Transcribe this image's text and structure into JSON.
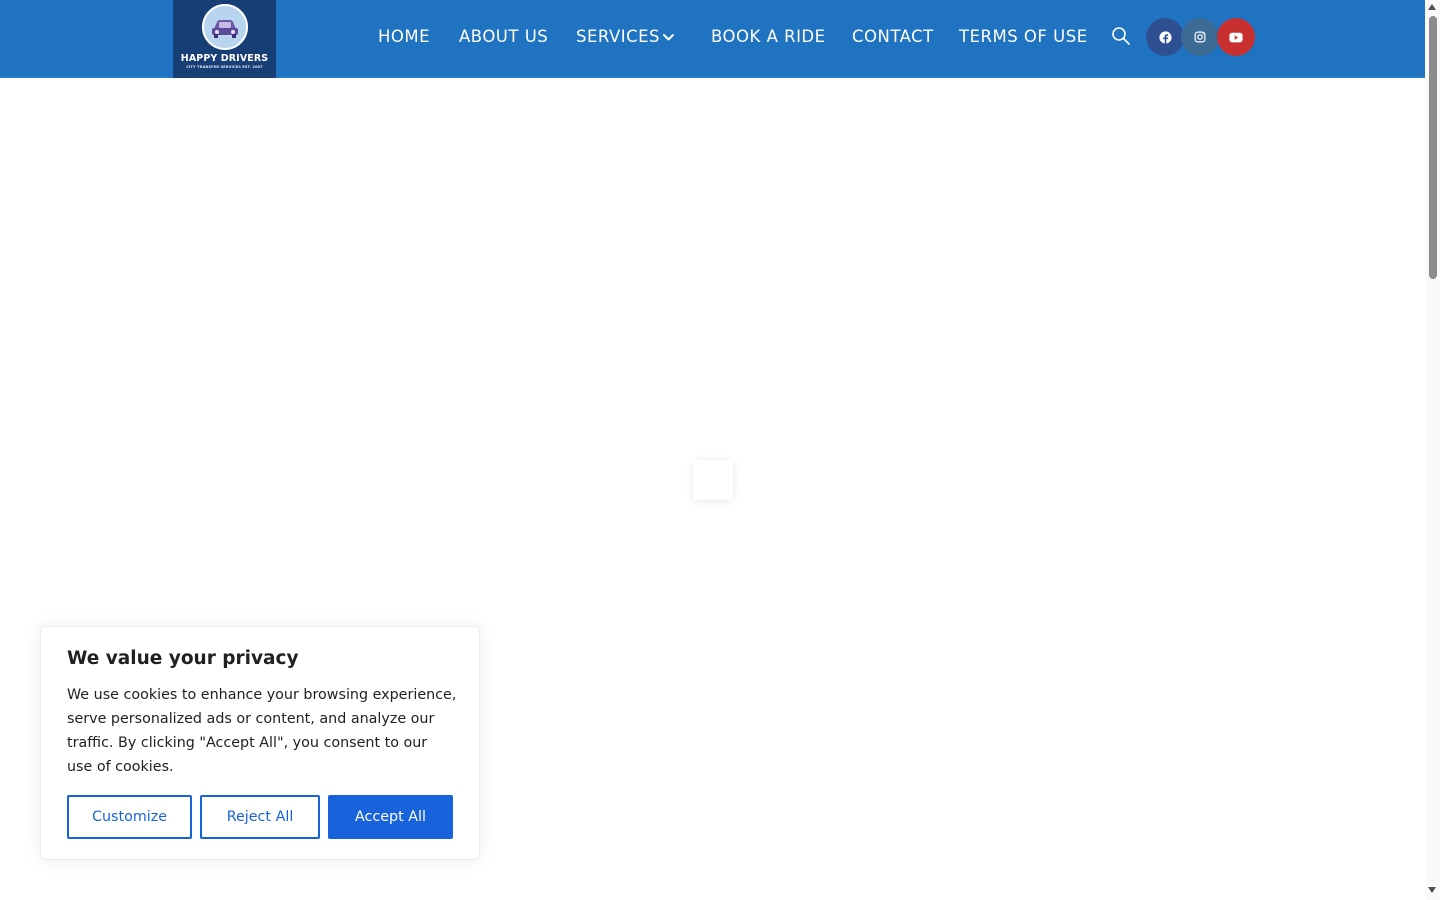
{
  "header": {
    "logo": {
      "title": "HAPPY DRIVERS",
      "subtitle": "CITY TRANSFER SERVICES EST. 2007"
    },
    "nav": [
      {
        "label": "HOME"
      },
      {
        "label": "ABOUT US"
      },
      {
        "label": "SERVICES",
        "has_dropdown": true
      },
      {
        "label": "BOOK A RIDE"
      },
      {
        "label": "CONTACT"
      },
      {
        "label": "TERMS OF USE"
      }
    ],
    "icons": {
      "search": "search-icon",
      "chevron": "chevron-down-icon"
    },
    "social": [
      {
        "icon": "facebook-icon",
        "color": "#2f4f93"
      },
      {
        "icon": "instagram-icon",
        "color": "#3b6a94"
      },
      {
        "icon": "youtube-icon",
        "color": "#c7302f"
      }
    ]
  },
  "cookie_banner": {
    "title": "We value your privacy",
    "text": "We use cookies to enhance your browsing experience, serve personalized ads or content, and analyze our traffic. By clicking \"Accept All\", you consent to our use of cookies.",
    "buttons": {
      "customize": "Customize",
      "reject": "Reject All",
      "accept": "Accept All"
    }
  },
  "colors": {
    "header_bg": "#1f73c1",
    "logo_bg": "#183e76",
    "button_primary": "#1863dc"
  }
}
